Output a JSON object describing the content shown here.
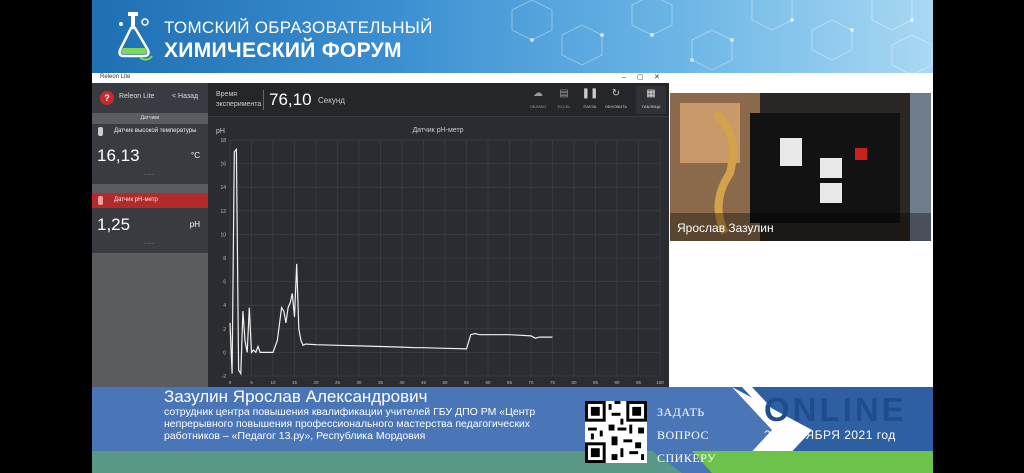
{
  "banner": {
    "line1": "ТОМСКИЙ ОБРАЗОВАТЕЛЬНЫЙ",
    "line2": "ХИМИЧЕСКИЙ ФОРУМ"
  },
  "app": {
    "window_title": "Releon Lite",
    "window_controls": [
      "‒",
      "▢",
      "✕"
    ],
    "sidebar": {
      "app_name": "Releon Lite",
      "back_label": "< Назад",
      "section_label": "Датчики",
      "sensors": [
        {
          "name": "Датчик высокой температуры",
          "value": "16,13",
          "unit": "°C",
          "active": false
        },
        {
          "name": "Датчик pH-метр",
          "value": "1,25",
          "unit": "pH",
          "active": true
        }
      ],
      "dots": "◦◦◦◦"
    },
    "toolbar": {
      "time_label_1": "Время",
      "time_label_2": "эксперимента",
      "time_value": "76,10",
      "time_unit": "Секунд",
      "buttons": [
        {
          "label": "ОБЛАКО",
          "icon": "cloud-icon"
        },
        {
          "label": "EXCEL",
          "icon": "excel-icon"
        },
        {
          "label": "ПАУЗА",
          "icon": "pause-icon"
        },
        {
          "label": "ОБНОВИТЬ",
          "icon": "refresh-icon"
        },
        {
          "label": "ТАБЛИЦА",
          "icon": "table-icon"
        }
      ]
    }
  },
  "chart_data": {
    "type": "line",
    "title": "Датчик pH-метр",
    "ylabel": "pH",
    "xlabel": "",
    "ylim": [
      -2,
      18
    ],
    "xlim": [
      0,
      100
    ],
    "yticks": [
      "-2",
      "0",
      "2",
      "4",
      "6",
      "8",
      "10",
      "12",
      "14",
      "16",
      "18"
    ],
    "xticks": [
      "0",
      "5",
      "10",
      "15",
      "20",
      "25",
      "30",
      "35",
      "40",
      "45",
      "50",
      "55",
      "60",
      "65",
      "70",
      "75",
      "80",
      "85",
      "90",
      "95",
      "100"
    ],
    "grid": true,
    "series": [
      {
        "x": [
          0,
          0.5,
          1,
          1.5,
          2,
          2.5,
          3,
          3.5,
          4,
          4.5,
          5,
          5.5,
          6,
          6.5,
          7,
          7.5,
          8,
          9,
          10,
          11,
          12,
          12.5,
          13,
          13.5,
          14,
          14.5,
          15,
          15.5,
          16,
          16.5,
          17,
          17.5,
          18,
          20,
          25,
          30,
          35,
          40,
          43,
          45,
          50,
          55,
          56,
          57,
          58,
          60,
          65,
          70,
          71,
          72,
          75
        ],
        "y": [
          2.5,
          -1.8,
          17,
          17.2,
          -1.5,
          -1.8,
          3.5,
          1,
          0,
          3.8,
          0,
          0.2,
          0,
          0.5,
          0,
          0,
          0,
          0,
          0,
          1,
          3.8,
          3.5,
          2.5,
          3.8,
          4.2,
          5,
          3,
          7.5,
          2,
          1,
          0.6,
          0.7,
          0.7,
          0.65,
          0.6,
          0.55,
          0.5,
          0.45,
          0.4,
          0.4,
          0.35,
          0.3,
          1.5,
          1.6,
          1.5,
          1.5,
          1.5,
          1.4,
          1.2,
          1.3,
          1.3
        ]
      }
    ]
  },
  "webcam": {
    "name": "Ярослав Зазулин"
  },
  "lower_third": {
    "name": "Зазулин Ярослав Александрович",
    "desc_line1": "сотрудник центра повышения квалификации учителей ГБУ ДПО РМ «Центр",
    "desc_line2": "непрерывного повышения профессионального мастерства педагогических",
    "desc_line3": "работников – «Педагог 13.ру», Республика Мордовия",
    "ask_line1": "ЗАДАТЬ",
    "ask_line2": "ВОПРОС",
    "ask_line3": "СПИКЕРУ",
    "online": "ONLINE",
    "dates": "2-3 НОЯБРЯ 2021 год"
  },
  "colors": {
    "banner_blue": "#1f6fb3",
    "lower_blue": "#4a76b8",
    "green_strip": "#6cc24a",
    "online_navy": "#1f4b8f",
    "app_dark": "#2b2c31",
    "active_red": "#b22a2a"
  }
}
